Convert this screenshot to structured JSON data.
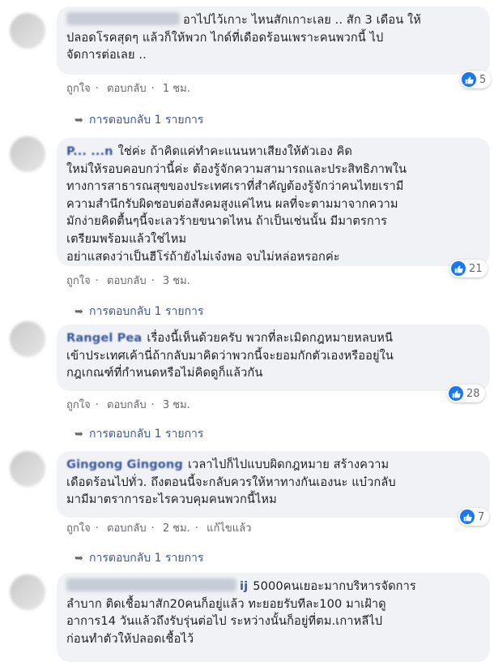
{
  "comments": [
    {
      "text_first": "อาไปไว้เกาะ ไหนสักเกาะเลย .. สัก 3 เดือน ให้",
      "text_rest": "ปลอดโรคสุดๆ แล้วก็ให้พวก ไกด์ที่เดือดร้อนเพราะคนพวกนี้ ไป\nจัดการต่อเลย ..",
      "like": "ถูกใจ",
      "reply": "ตอบกลับ",
      "time": "1 ชม.",
      "reactions": "5",
      "replies_label": "การตอบกลับ 1 รายการ"
    },
    {
      "name": "P... ...n",
      "text_first": "ใช่ค่ะ ถ้าคิดแค่ทำคะแนนหาเสียงให้ตัวเอง คิด",
      "text_rest": "ใหม่ให้รอบคอบกว่านี้ค่ะ ต้องรู้จักความสามารถและประสิทธิภาพใน\nทางการสาธารณสุขของประเทศเราที่สำคัญต้องรู้จักว่าคนไทยเรามี\nความสำนึกรับผิดชอบต่อสังคมสูงแค่ไหน ผลที่จะตามมาจากความ\nมักง่ายคิดตื้นๆนี้จะเลวร้ายขนาดไหน ถ้าเป็นเช่นนั้น มีมาตรการ\nเตรียมพร้อมแล้วใช่ไหม\nอย่าแสดงว่าเป็นฮีโร่ถ้ายังไม่เจ๋งพอ จบไม่หล่อหรอกค่ะ",
      "like": "ถูกใจ",
      "reply": "ตอบกลับ",
      "time": "3 ชม.",
      "reactions": "21",
      "replies_label": "การตอบกลับ 1 รายการ"
    },
    {
      "name": "Rangel Pea",
      "text_first": "เรื่องนี้เห็นด้วยครับ พวกที่ละเมิดกฎหมายหลบหนี",
      "text_rest": "เข้าประเทศเค้านี่ถ้ากลับมาคิดว่าพวกนี้จะยอมกักตัวเองหรืออยู่ใน\nกฎเกณฑ์ที่กำหนดหรือไม่คิดดูก็แล้วกัน",
      "like": "ถูกใจ",
      "reply": "ตอบกลับ",
      "time": "3 ชม.",
      "reactions": "28",
      "replies_label": "การตอบกลับ 1 รายการ"
    },
    {
      "name": "Gingong Gingong",
      "text_first": "เวลาไปก็ไปแบบผิดกฎหมาย สร้างความ",
      "text_rest": "เดือดร้อนไปทั่ว. ถึงตอนนี้จะกลับควรให้หาทางกันเองนะ แบ๋วกลับ\nมามีมาตราการอะไรควบคุมคนพวกนี้ไหม",
      "like": "ถูกใจ",
      "reply": "ตอบกลับ",
      "time": "2 ชม.",
      "edited": "แก้ไขแล้ว",
      "reactions": "7",
      "replies_label": "การตอบกลับ 1 รายการ"
    },
    {
      "name_tail": "ij",
      "text_first": "5000คนเยอะมากบริหารจัดการ",
      "text_rest": "ลำบาก ติดเชื้อมาสัก20คนก็อยู่แล้ว ทะยอยรับทีละ100 มาเฝ้าดู\nอาการ14 วันแล้วถึงรับรุ่นต่อไป ระหว่างนั้นก็อยู่ที่ตม.เกาหลีไป\nก่อนทำตัวให้ปลอดเชื้อไว้"
    }
  ],
  "colors": {
    "bubble": "#f0f2f5",
    "link": "#385898",
    "like": "#1877f2",
    "meta": "#65676b"
  }
}
